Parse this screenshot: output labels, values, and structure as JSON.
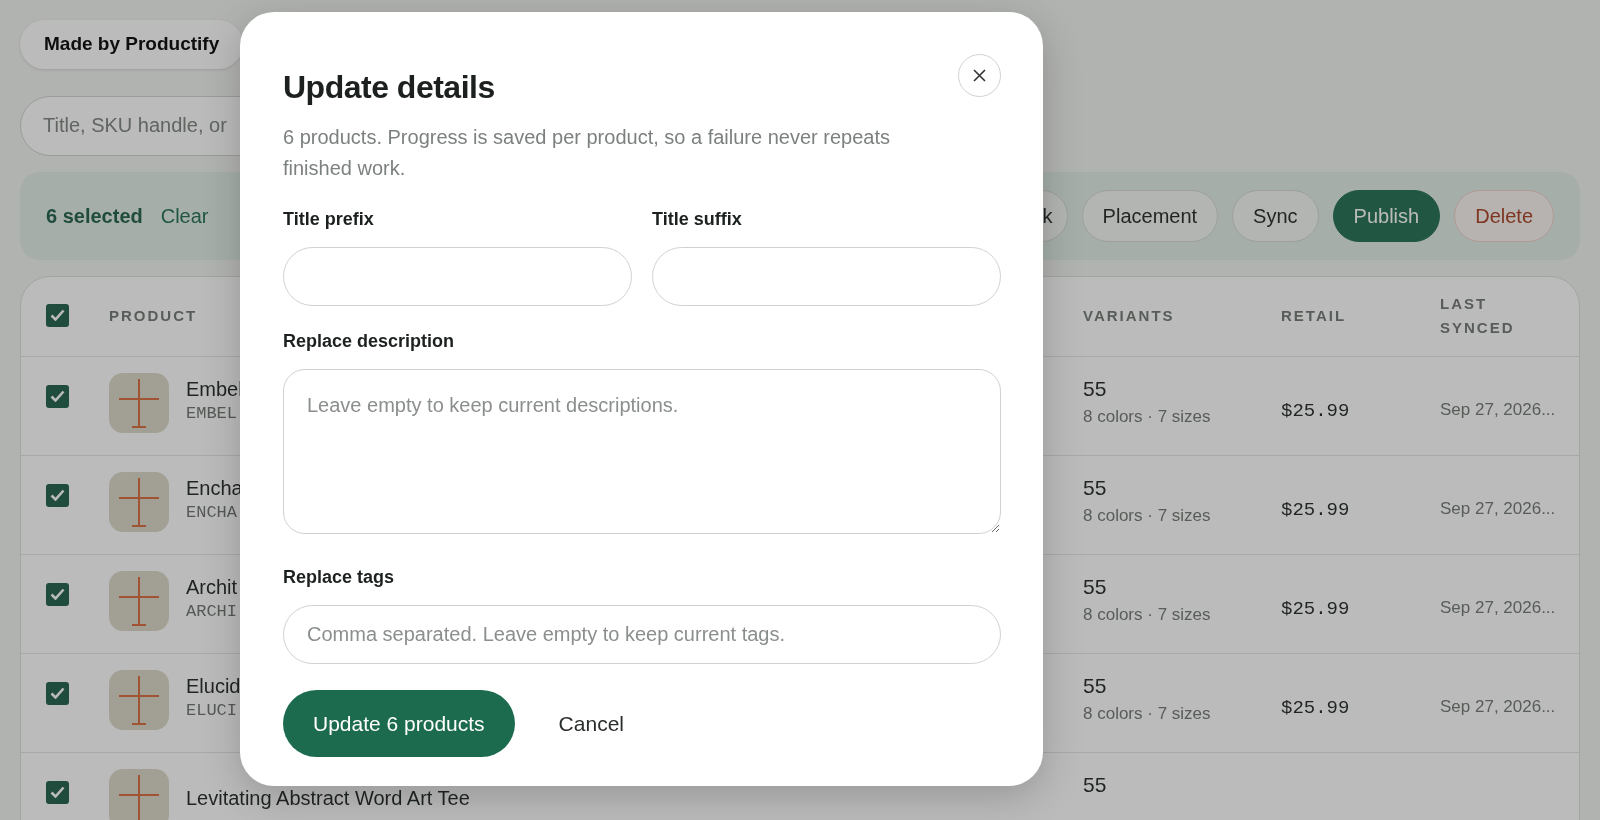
{
  "store_filter": {
    "label": "Made by Productify"
  },
  "search": {
    "placeholder": "Title, SKU handle, or"
  },
  "selection_bar": {
    "count": "6 selected",
    "clear": "Clear",
    "actions": [
      {
        "label": "k",
        "kind": "outline"
      },
      {
        "label": "Placement",
        "kind": "outline"
      },
      {
        "label": "Sync",
        "kind": "outline"
      },
      {
        "label": "Publish",
        "kind": "primary"
      },
      {
        "label": "Delete",
        "kind": "danger"
      }
    ]
  },
  "table": {
    "all_checked": true,
    "columns": [
      "PRODUCT",
      "VARIANTS",
      "RETAIL",
      "LAST SYNCED"
    ],
    "rows": [
      {
        "checked": true,
        "title": "Embel",
        "sku": "EMBEL",
        "variants": "55",
        "variant_detail": "8 colors · 7 sizes",
        "retail": "$25.99",
        "last_synced": "Sep 27, 2026..."
      },
      {
        "checked": true,
        "title": "Encha",
        "sku": "ENCHA",
        "variants": "55",
        "variant_detail": "8 colors · 7 sizes",
        "retail": "$25.99",
        "last_synced": "Sep 27, 2026..."
      },
      {
        "checked": true,
        "title": "Archit",
        "sku": "ARCHI",
        "variants": "55",
        "variant_detail": "8 colors · 7 sizes",
        "retail": "$25.99",
        "last_synced": "Sep 27, 2026..."
      },
      {
        "checked": true,
        "title": "Elucid",
        "sku": "ELUCI",
        "variants": "55",
        "variant_detail": "8 colors · 7 sizes",
        "retail": "$25.99",
        "last_synced": "Sep 27, 2026..."
      },
      {
        "checked": true,
        "title": "Levitating Abstract Word Art Tee",
        "variants": "55"
      }
    ]
  },
  "modal": {
    "title": "Update details",
    "description": "6 products. Progress is saved per product, so a failure never repeats finished work.",
    "field_rows": [
      [
        {
          "label": "Title prefix",
          "kind": "input"
        },
        {
          "label": "Title suffix",
          "kind": "input"
        }
      ],
      [
        {
          "label": "Replace description",
          "kind": "textarea",
          "placeholder": "Leave empty to keep current descriptions."
        }
      ],
      [
        {
          "label": "Replace tags",
          "kind": "input",
          "placeholder": "Comma separated. Leave empty to keep current tags."
        }
      ]
    ],
    "submit": "Update 6 products",
    "cancel": "Cancel"
  }
}
